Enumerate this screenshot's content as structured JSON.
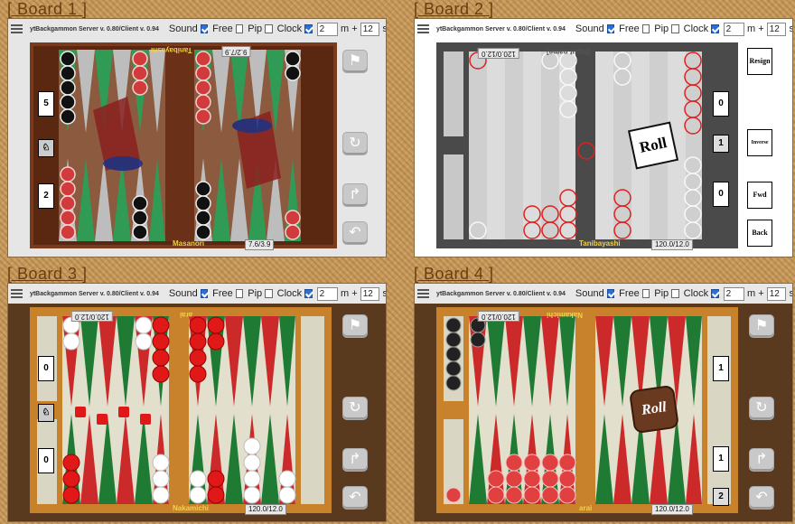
{
  "boards": [
    {
      "title": "[ Board 1 ]",
      "server": "ytBackgammon Server v. 0.80/Client v. 0.94",
      "sound": "Sound",
      "free": "Free",
      "pip": "Pip",
      "clock": "Clock",
      "clock_val": "2",
      "m_label": "m +",
      "plus_val": "12",
      "s_label": "s",
      "top_player": "Tanibayashi",
      "top_score": "9.2/7.9",
      "bottom_player": "Masanori",
      "bottom_score": "7.6/3.9",
      "cube_top": "5",
      "cube_bottom": "2"
    },
    {
      "title": "[ Board 2 ]",
      "server": "ytBackgammon Server v. 0.80/Client v. 0.94",
      "sound": "Sound",
      "free": "Free",
      "pip": "Pip",
      "clock": "Clock",
      "clock_val": "2",
      "m_label": "m +",
      "plus_val": "12",
      "s_label": "s",
      "top_player": "[Input name]",
      "top_score": "120.0/12.0",
      "bottom_player": "Tanibayashi",
      "bottom_score": "120.0/12.0",
      "roll": "Roll",
      "cube_mid": "1",
      "cube_top": "0",
      "cube_bottom": "0",
      "btn_resign": "Resign",
      "btn_inverse": "Inverse",
      "btn_fwd": "Fwd",
      "btn_back": "Back"
    },
    {
      "title": "[ Board 3 ]",
      "server": "ytBackgammon Server v. 0.80/Client v. 0.94",
      "sound": "Sound",
      "free": "Free",
      "pip": "Pip",
      "clock": "Clock",
      "clock_val": "2",
      "m_label": "m +",
      "plus_val": "12",
      "s_label": "s",
      "top_player": "arai",
      "top_score": "120.0/12.0",
      "bottom_player": "Nakamichi",
      "bottom_score": "120.0/12.0",
      "cube_top": "0",
      "cube_bottom": "0"
    },
    {
      "title": "[ Board 4 ]",
      "server": "ytBackgammon Server v. 0.80/Client v. 0.94",
      "sound": "Sound",
      "free": "Free",
      "pip": "Pip",
      "clock": "Clock",
      "clock_val": "2",
      "m_label": "m +",
      "plus_val": "12",
      "s_label": "s",
      "top_player": "Nakamichi",
      "top_score": "120.0/12.0",
      "bottom_player": "arai",
      "bottom_score": "120.0/12.0",
      "roll": "Roll",
      "cube_top": "1",
      "cube_bottom": "1",
      "cube_mid": "2"
    }
  ]
}
